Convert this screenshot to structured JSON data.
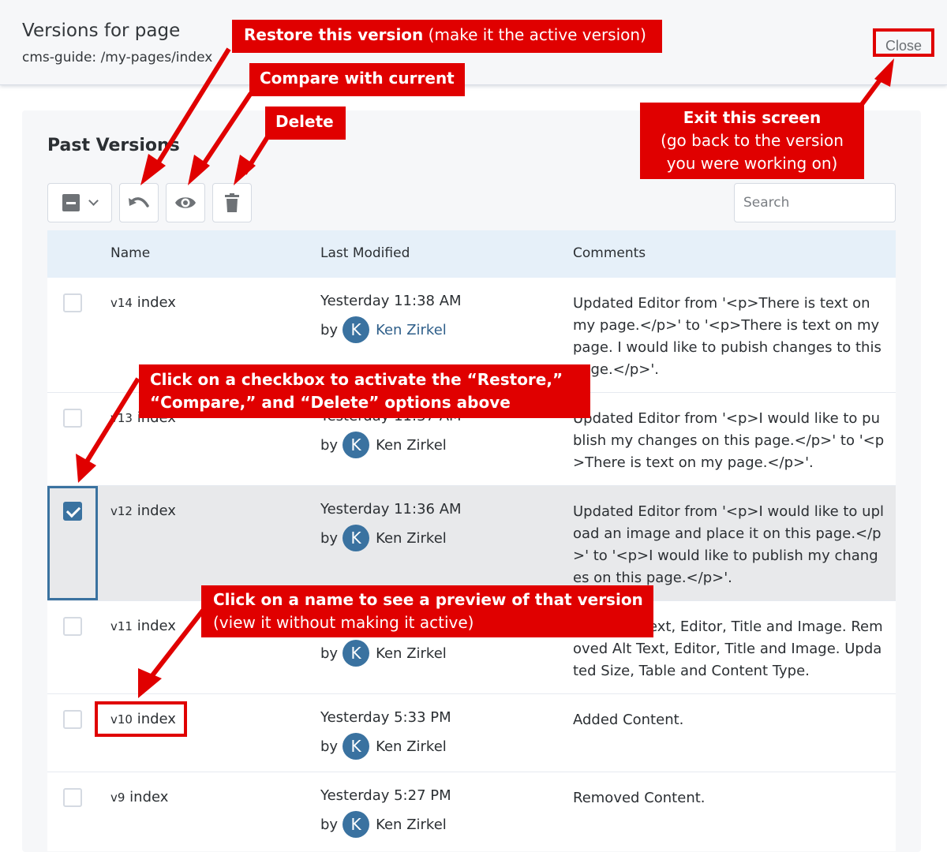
{
  "header": {
    "title": "Versions for page",
    "subtitle": "cms-guide: /my-pages/index",
    "close_label": "Close"
  },
  "panel": {
    "title": "Past Versions",
    "search_placeholder": "Search",
    "toolbar": {
      "select_icon": "minus-square-icon",
      "dropdown_icon": "chevron-down-icon",
      "restore_icon": "undo-icon",
      "compare_icon": "eye-icon",
      "delete_icon": "trash-icon"
    }
  },
  "table": {
    "columns": [
      "Name",
      "Last Modified",
      "Comments"
    ],
    "rows": [
      {
        "version": "v14",
        "name": "index",
        "date": "Yesterday 11:38 AM",
        "by": "by",
        "avatar": "K",
        "author": "Ken Zirkel",
        "checked": false,
        "comment": "Updated Editor from '<p>There is text on my page.</p>' to '<p>There is text on my page. I would like to pubish changes to this page.</p>'."
      },
      {
        "version": "v13",
        "name": "index",
        "date": "Yesterday 11:37 AM",
        "by": "by",
        "avatar": "K",
        "author": "Ken Zirkel",
        "checked": false,
        "comment": "Updated Editor from '<p>I would like to publish my changes on this page.</p>' to '<p>There is text on my page.</p>'."
      },
      {
        "version": "v12",
        "name": "index",
        "date": "Yesterday 11:36 AM",
        "by": "by",
        "avatar": "K",
        "author": "Ken Zirkel",
        "checked": true,
        "comment": "Updated Editor from '<p>I would like to upload an image and place it on this page.</p>' to '<p>I would like to publish my changes on this page.</p>'."
      },
      {
        "version": "v11",
        "name": "index",
        "date": "",
        "by": "by",
        "avatar": "K",
        "author": "Ken Zirkel",
        "checked": false,
        "comment": "ext, Editor, Title and Image. Removed Alt Text, Editor, Title and Image. Updated Size, Table and Content Type."
      },
      {
        "version": "v10",
        "name": "index",
        "date": "Yesterday 5:33 PM",
        "by": "by",
        "avatar": "K",
        "author": "Ken Zirkel",
        "checked": false,
        "comment": "Added Content."
      },
      {
        "version": "v9",
        "name": "index",
        "date": "Yesterday 5:27 PM",
        "by": "by",
        "avatar": "K",
        "author": "Ken Zirkel",
        "checked": false,
        "comment": "Removed Content."
      }
    ]
  },
  "callouts": {
    "restore_bold": "Restore this version",
    "restore_rest": " (make it the active version)",
    "compare": "Compare with current",
    "delete": "Delete",
    "exit_line1": "Exit this screen",
    "exit_line2": "(go back to the version",
    "exit_line3": "you were working on)",
    "checkbox_line1": "Click on a checkbox to activate the “Restore,”",
    "checkbox_line2": "“Compare,” and “Delete” options above",
    "preview_line1": "Click on a name to see a preview of that version",
    "preview_line2": "(view it without making it active)"
  },
  "colors": {
    "annotation_red": "#e00000",
    "accent_blue": "#3a72a0",
    "header_bg": "#e6f0f9"
  }
}
